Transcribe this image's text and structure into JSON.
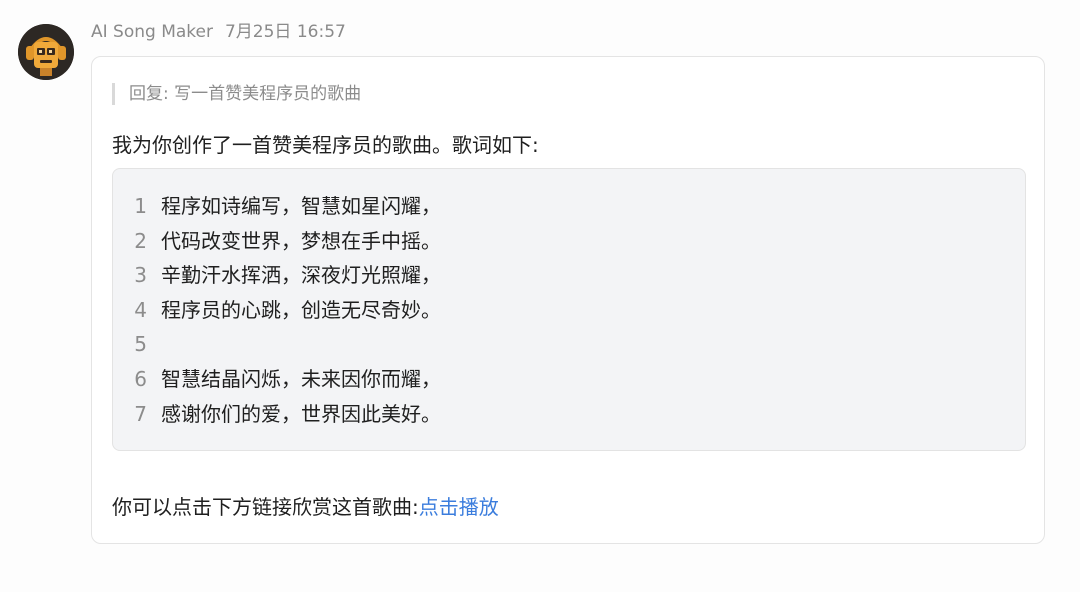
{
  "message": {
    "sender": "AI Song Maker",
    "timestamp": "7月25日 16:57",
    "avatar_icon": "robot-headphones-icon",
    "reply_quote": "回复: 写一首赞美程序员的歌曲",
    "intro_text": "我为你创作了一首赞美程序员的歌曲。歌词如下:",
    "lyrics": [
      {
        "num": "1",
        "text": "程序如诗编写，智慧如星闪耀，"
      },
      {
        "num": "2",
        "text": "代码改变世界，梦想在手中摇。"
      },
      {
        "num": "3",
        "text": "辛勤汗水挥洒，深夜灯光照耀，"
      },
      {
        "num": "4",
        "text": "程序员的心跳，创造无尽奇妙。"
      },
      {
        "num": "5",
        "text": ""
      },
      {
        "num": "6",
        "text": "智慧结晶闪烁，未来因你而耀，"
      },
      {
        "num": "7",
        "text": "感谢你们的爱，世界因此美好。"
      }
    ],
    "outro_text": "你可以点击下方链接欣赏这首歌曲:",
    "play_link_label": "点击播放"
  },
  "colors": {
    "link": "#3b7ddd",
    "muted_text": "#8a8a8a",
    "code_background": "#f3f4f6"
  }
}
